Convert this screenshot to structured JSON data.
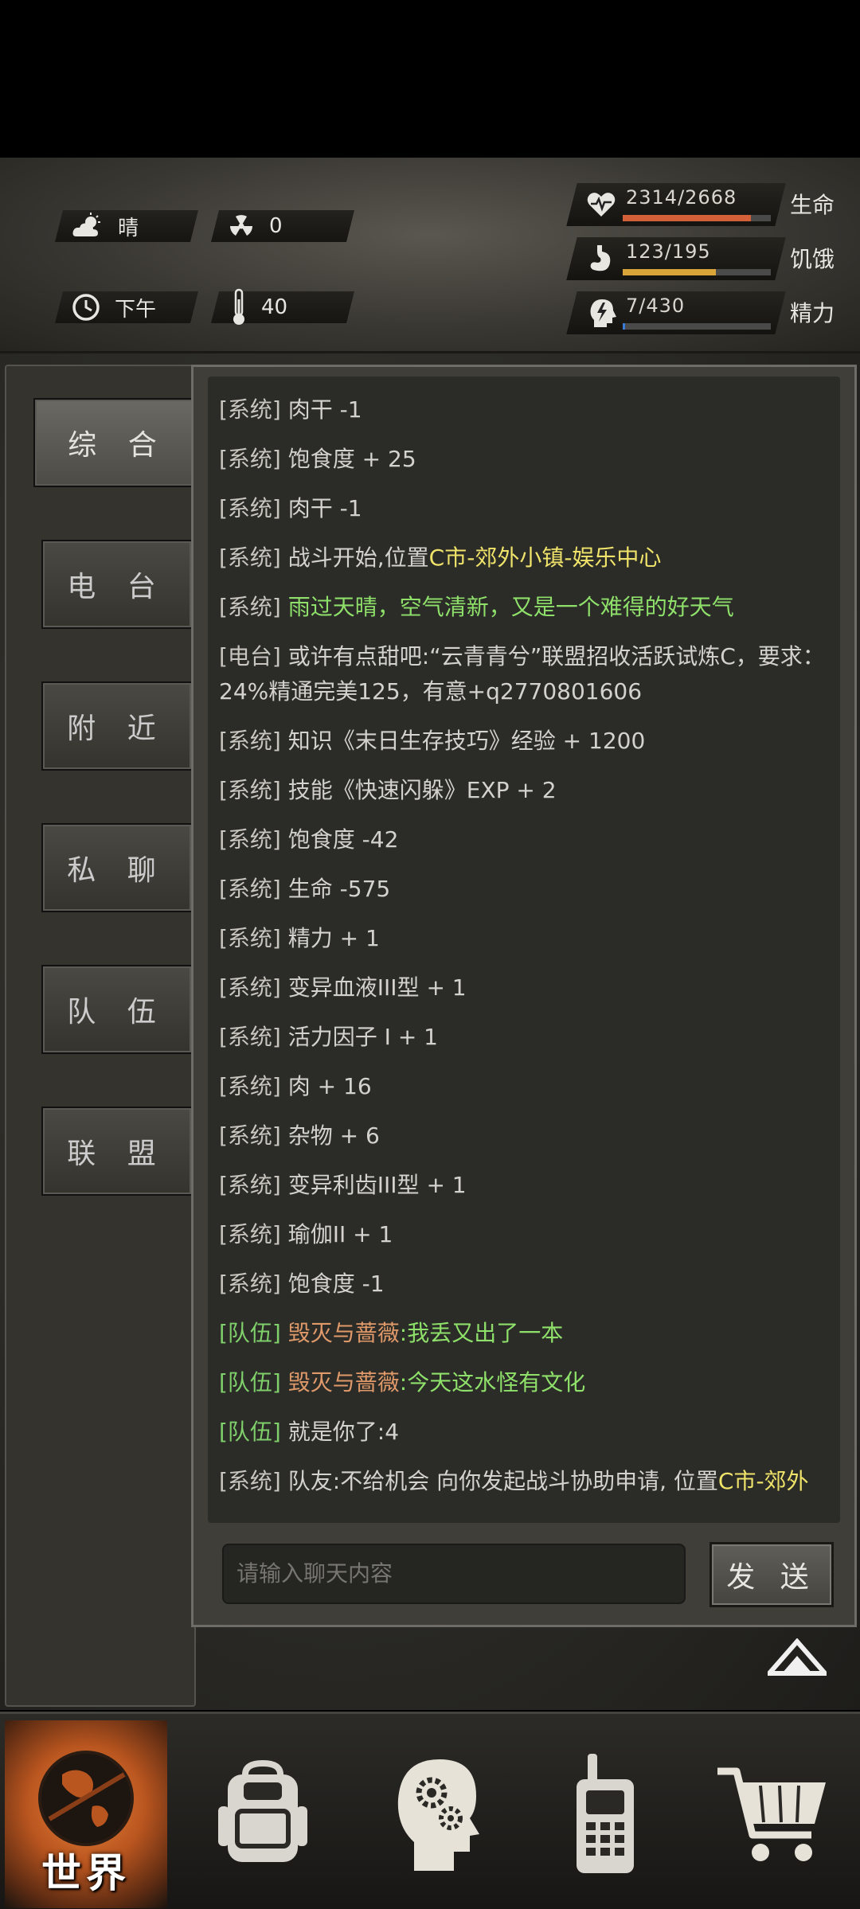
{
  "status": {
    "weather_label": "晴",
    "radiation_value": "0",
    "time_label": "下午",
    "temperature_value": "40"
  },
  "vitals": [
    {
      "name": "生命",
      "value": "2314/2668",
      "fill": 0.867,
      "color": "#d4603a",
      "icon": "heart-pulse-icon"
    },
    {
      "name": "饥饿",
      "value": "123/195",
      "fill": 0.631,
      "color": "#d9a43a",
      "icon": "stomach-icon"
    },
    {
      "name": "精力",
      "value": "7/430",
      "fill": 0.016,
      "color": "#3a7ad9",
      "icon": "head-lightning-icon"
    }
  ],
  "tabs": [
    "综 合",
    "电 台",
    "附 近",
    "私 聊",
    "队 伍",
    "联 盟"
  ],
  "active_tab": 0,
  "messages": [
    {
      "tag": "[系统]",
      "parts": [
        {
          "t": "肉干 -1"
        }
      ]
    },
    {
      "tag": "[系统]",
      "parts": [
        {
          "t": "饱食度 + 25"
        }
      ]
    },
    {
      "tag": "[系统]",
      "parts": [
        {
          "t": "肉干 -1"
        }
      ]
    },
    {
      "tag": "[系统]",
      "parts": [
        {
          "t": "战斗开始,位置"
        },
        {
          "t": "C市-郊外小镇-娱乐中心",
          "c": "c-yellow"
        }
      ]
    },
    {
      "tag": "[系统]",
      "parts": [
        {
          "t": "雨过天晴，空气清新，又是一个难得的好天气",
          "c": "c-green"
        }
      ]
    },
    {
      "tag": "[电台]",
      "parts": [
        {
          "t": "或许有点甜吧:“云青青兮”联盟招收活跃试炼C，要求：24%精通完美125，有意+q2770801606"
        }
      ]
    },
    {
      "tag": "[系统]",
      "parts": [
        {
          "t": "知识《末日生存技巧》经验 + 1200"
        }
      ]
    },
    {
      "tag": "[系统]",
      "parts": [
        {
          "t": "技能《快速闪躲》EXP + 2"
        }
      ]
    },
    {
      "tag": "[系统]",
      "parts": [
        {
          "t": "饱食度 -42"
        }
      ]
    },
    {
      "tag": "[系统]",
      "parts": [
        {
          "t": "生命 -575"
        }
      ]
    },
    {
      "tag": "[系统]",
      "parts": [
        {
          "t": "精力 + 1"
        }
      ]
    },
    {
      "tag": "[系统]",
      "parts": [
        {
          "t": "变异血液III型 + 1"
        }
      ]
    },
    {
      "tag": "[系统]",
      "parts": [
        {
          "t": "活力因子 I  + 1"
        }
      ]
    },
    {
      "tag": "[系统]",
      "parts": [
        {
          "t": "肉 + 16"
        }
      ]
    },
    {
      "tag": "[系统]",
      "parts": [
        {
          "t": "杂物 + 6"
        }
      ]
    },
    {
      "tag": "[系统]",
      "parts": [
        {
          "t": "变异利齿III型 + 1"
        }
      ]
    },
    {
      "tag": "[系统]",
      "parts": [
        {
          "t": "瑜伽II  + 1"
        }
      ]
    },
    {
      "tag": "[系统]",
      "parts": [
        {
          "t": "饱食度 -1"
        }
      ]
    },
    {
      "tag": "[队伍]",
      "team": true,
      "parts": [
        {
          "t": "毁灭与蔷薇",
          "c": "c-orange"
        },
        {
          "t": ":我丢又出了一本",
          "c": "c-green"
        }
      ]
    },
    {
      "tag": "[队伍]",
      "team": true,
      "parts": [
        {
          "t": "毁灭与蔷薇",
          "c": "c-orange"
        },
        {
          "t": ":今天这水怪有文化",
          "c": "c-green"
        }
      ]
    },
    {
      "tag": "[队伍]",
      "team": true,
      "parts": [
        {
          "t": "就是你了:4"
        }
      ]
    },
    {
      "tag": "[系统]",
      "parts": [
        {
          "t": "队友:不给机会 向你发起战斗协助申请, 位置"
        },
        {
          "t": "C市-郊外",
          "c": "c-yellow"
        }
      ]
    }
  ],
  "chat_input": {
    "placeholder": "请输入聊天内容"
  },
  "send_label": "发 送",
  "bottom_nav": [
    {
      "label": "世界",
      "icon": "globe-icon"
    },
    {
      "icon": "backpack-icon"
    },
    {
      "icon": "brain-gears-icon"
    },
    {
      "icon": "walkie-talkie-icon"
    },
    {
      "icon": "shopping-cart-icon"
    }
  ]
}
